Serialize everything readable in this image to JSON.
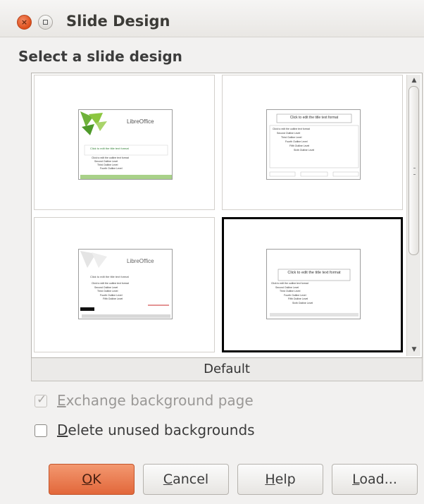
{
  "window": {
    "title": "Slide Design"
  },
  "heading": "Select a slide design",
  "gallery": {
    "items": [
      {
        "brand": "LibreOffice",
        "title_text": "Click to edit the title text format",
        "outline": [
          "Click to edit the outline text format",
          "Second Outline Level",
          "Third Outline Level",
          "Fourth Outline Level",
          "Fifth Outline Level",
          "Sixth Outline Level"
        ]
      },
      {
        "title_text": "Click to edit the title text format",
        "outline": [
          "Click to edit the outline text format",
          "Second Outline Level",
          "Third Outline Level",
          "Fourth Outline Level",
          "Fifth Outline Level",
          "Sixth Outline Level"
        ]
      },
      {
        "brand": "LibreOffice",
        "title_text": "Click to edit the title text format",
        "outline": [
          "Click to edit the outline text format",
          "Second Outline Level",
          "Third Outline Level",
          "Fourth Outline Level",
          "Fifth Outline Level",
          "Sixth Outline Level"
        ]
      },
      {
        "title_text": "Click to edit the title text format",
        "outline": [
          "Click to edit the outline text format",
          "Second Outline Level",
          "Third Outline Level",
          "Fourth Outline Level",
          "Fifth Outline Level",
          "Sixth Outline Level"
        ]
      }
    ],
    "selected_name": "Default"
  },
  "options": {
    "exchange_prefix": "E",
    "exchange_rest": "xchange background page",
    "exchange_checked": true,
    "exchange_enabled": false,
    "delete_prefix": "D",
    "delete_rest": "elete unused backgrounds",
    "delete_checked": false
  },
  "buttons": {
    "ok_u": "O",
    "ok_rest": "K",
    "cancel_u": "C",
    "cancel_rest": "ancel",
    "help_u": "H",
    "help_rest": "elp",
    "load_u": "L",
    "load_rest": "oad..."
  },
  "colors": {
    "accent": "#e2673a",
    "close_button": "#dd4f1b",
    "leaf_green": "#6fb23a"
  }
}
